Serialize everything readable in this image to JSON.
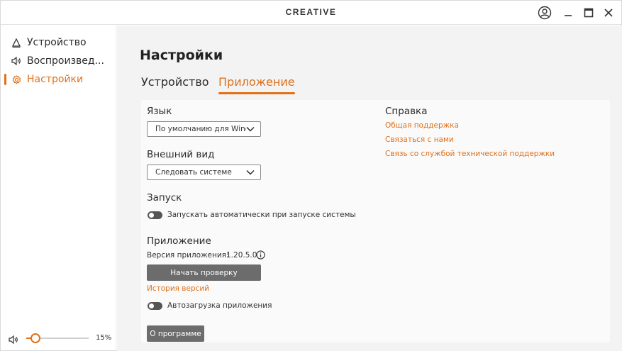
{
  "window": {
    "logo": "CREATIVE"
  },
  "titlebar": {
    "icons": [
      "account-icon",
      "minimize-icon",
      "maximize-icon",
      "close-icon"
    ]
  },
  "sidebar": {
    "items": [
      {
        "label": "Устройство",
        "icon": "device-icon",
        "active": false
      },
      {
        "label": "Воспроизвед...",
        "icon": "speaker-icon",
        "active": false
      },
      {
        "label": "Настройки",
        "icon": "gear-icon",
        "active": true
      }
    ],
    "volume": {
      "percent_label": "15%",
      "level": 0.15,
      "icon": "speaker-icon"
    }
  },
  "main": {
    "title": "Настройки",
    "tabs": [
      {
        "label": "Устройство",
        "active": false
      },
      {
        "label": "Приложение",
        "active": true
      }
    ],
    "language": {
      "title": "Язык",
      "value": "По умолчанию для Windows"
    },
    "appearance": {
      "title": "Внешний вид",
      "value": "Следовать системе"
    },
    "startup": {
      "title": "Запуск",
      "toggle_label": "Запускать автоматически при запуске системы"
    },
    "application": {
      "title": "Приложение",
      "version_label": "Версия приложения:",
      "version_value": "1.20.5.0",
      "check_button": "Начать проверку",
      "history_link": "История версий",
      "autoload_label": "Автозагрузка приложения",
      "about_button": "О программе"
    },
    "help": {
      "title": "Справка",
      "links": [
        "Общая поддержка",
        "Связаться с нами",
        "Связь со службой технической поддержки"
      ]
    }
  },
  "colors": {
    "accent": "#e0701a",
    "button": "#6c6c6c",
    "panel": "#f3f3f3"
  }
}
